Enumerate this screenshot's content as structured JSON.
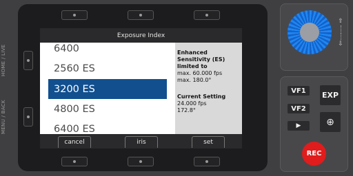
{
  "side_labels": {
    "home_live": "HOME / LIVE",
    "menu_back": "MENU / BACK"
  },
  "screen": {
    "title": "Exposure Index",
    "iso_list": [
      {
        "label": "6400",
        "selected": false
      },
      {
        "label": "2560 ES",
        "selected": false
      },
      {
        "label": "3200 ES",
        "selected": true
      },
      {
        "label": "4800 ES",
        "selected": false
      },
      {
        "label": "6400 ES",
        "selected": false
      }
    ],
    "info": {
      "heading": "Enhanced Sensitivity (ES) limited to",
      "max_fps": "max. 60.000 fps",
      "max_angle": "max. 180.0°",
      "current_heading": "Current Setting",
      "current_fps": "24.000 fps",
      "current_angle": "172.8°"
    },
    "footer": {
      "cancel": "cancel",
      "iris": "iris",
      "set": "set"
    }
  },
  "controls": {
    "vf1": "VF1",
    "vf2": "VF2",
    "play": "▶",
    "exp": "EXP",
    "zoom": "⊕",
    "rec": "REC"
  },
  "colors": {
    "selection": "#114f8f",
    "wheel_blue": "#1f86f2",
    "rec_red": "#e01c1c"
  }
}
